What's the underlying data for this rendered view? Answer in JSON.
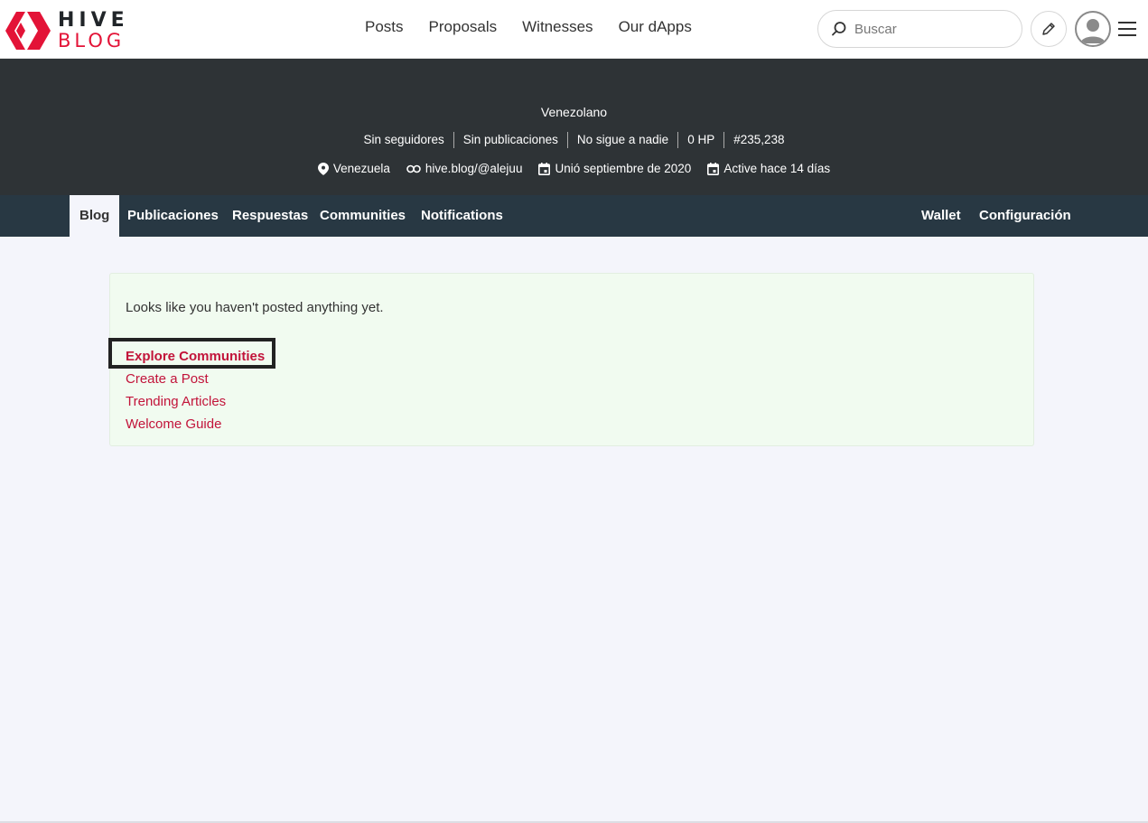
{
  "logo": {
    "line1": "HIVE",
    "line2": "BLOG"
  },
  "topnav": [
    "Posts",
    "Proposals",
    "Witnesses",
    "Our dApps"
  ],
  "search": {
    "placeholder": "Buscar"
  },
  "profile": {
    "name": "Venezolano",
    "stats": [
      "Sin seguidores",
      "Sin publicaciones",
      "No sigue a nadie",
      "0 HP",
      "#235,238"
    ],
    "location": "Venezuela",
    "website": "hive.blog/@alejuu",
    "joined": "Unió septiembre de 2020",
    "active": "Active hace 14 días"
  },
  "tabs": {
    "blog": "Blog",
    "posts": "Publicaciones",
    "replies": "Respuestas",
    "communities": "Communities",
    "notifications": "Notifications",
    "wallet": "Wallet",
    "settings": "Configuración"
  },
  "content": {
    "empty_message": "Looks like you haven't posted anything yet.",
    "links": [
      "Explore Communities",
      "Create a Post",
      "Trending Articles",
      "Welcome Guide"
    ]
  },
  "colors": {
    "accent": "#e31337",
    "banner": "#2e3336",
    "tabs": "#283843"
  }
}
